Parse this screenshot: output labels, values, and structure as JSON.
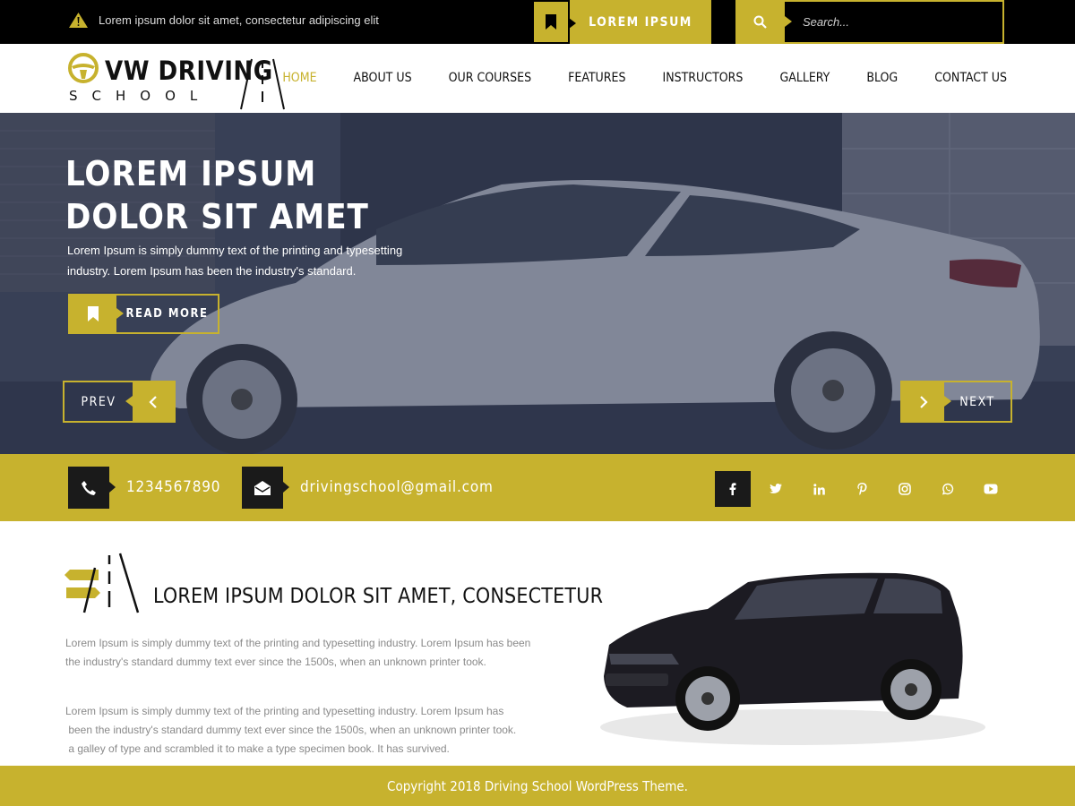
{
  "topbar": {
    "notice": "Lorem ipsum dolor sit amet, consectetur adipiscing elit",
    "cta_label": "LOREM IPSUM",
    "search_placeholder": "Search..."
  },
  "header": {
    "logo_title": "VW DRIVING",
    "logo_sub": "SCHOOL",
    "nav": [
      {
        "label": "HOME",
        "active": true
      },
      {
        "label": "ABOUT US"
      },
      {
        "label": "OUR COURSES"
      },
      {
        "label": "FEATURES"
      },
      {
        "label": "INSTRUCTORS"
      },
      {
        "label": "GALLERY"
      },
      {
        "label": "BLOG"
      },
      {
        "label": "CONTACT US"
      }
    ]
  },
  "hero": {
    "title_line1": "LOREM IPSUM",
    "title_line2": "DOLOR SIT AMET",
    "lead_line1": "Lorem Ipsum is simply dummy text of the printing and typesetting",
    "lead_line2": "industry. Lorem Ipsum has been the industry's standard.",
    "read_more": "READ MORE",
    "prev": "PREV",
    "next": "NEXT"
  },
  "contact": {
    "phone": "1234567890",
    "email": "drivingschool@gmail.com",
    "social": [
      "facebook-icon",
      "twitter-icon",
      "linkedin-icon",
      "pinterest-icon",
      "instagram-icon",
      "whatsapp-icon",
      "youtube-icon"
    ]
  },
  "about": {
    "heading": "LOREM IPSUM DOLOR SIT AMET, CONSECTETUR",
    "p1_line1": "Lorem Ipsum is simply dummy text of the printing and typesetting industry. Lorem Ipsum has been",
    "p1_line2": "the industry's standard dummy text ever since the 1500s, when an unknown printer took.",
    "p2_line1": "Lorem Ipsum is simply dummy text of the printing and typesetting industry. Lorem Ipsum has",
    "p2_line2": " been the industry's standard dummy text ever since the 1500s, when an unknown printer took.",
    "p2_line3": " a galley of type and scrambled it to make a type specimen book. It has survived."
  },
  "footer": {
    "copyright": "Copyright 2018 Driving School WordPress Theme."
  },
  "colors": {
    "accent": "#c7b22e",
    "dark": "#000000",
    "hero_overlay": "#3d4558"
  }
}
